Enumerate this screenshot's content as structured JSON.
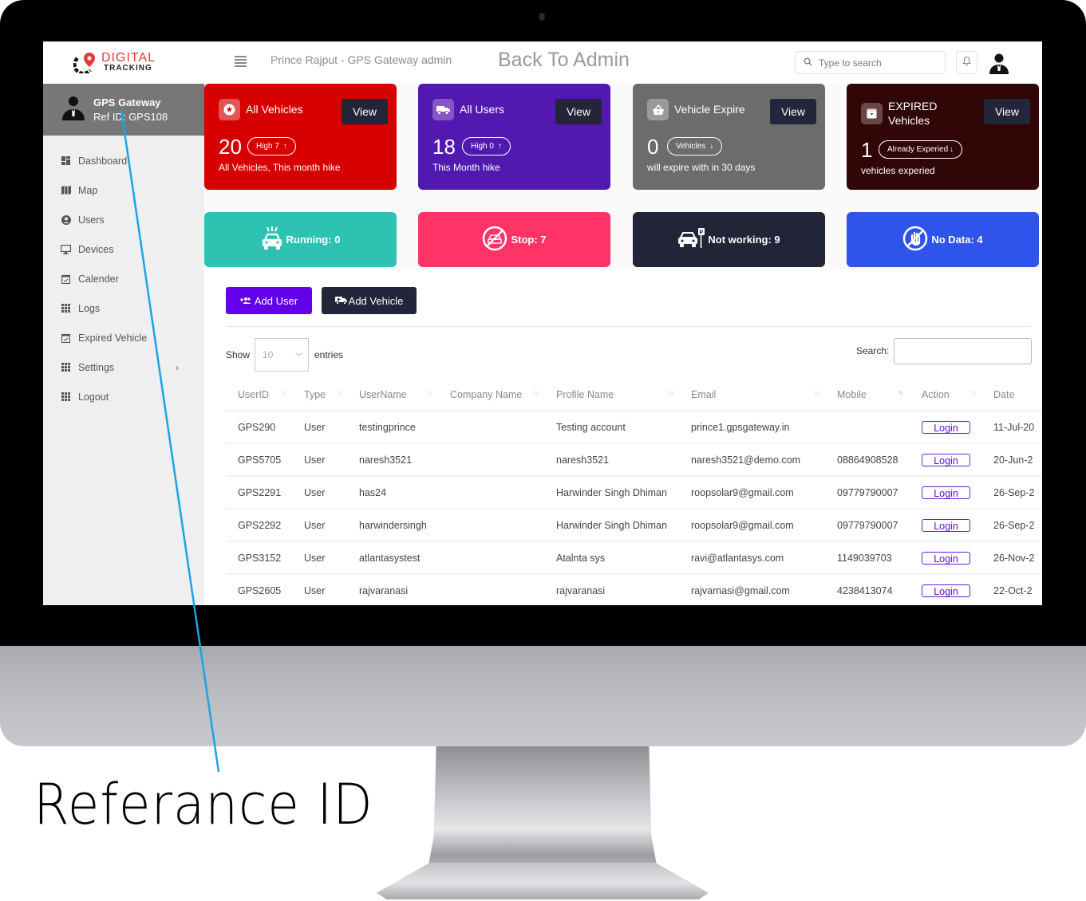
{
  "header": {
    "logo": {
      "line1": "DIGITAL",
      "line2": "TRACKING",
      "icon": "map-pin-logo-icon"
    },
    "admin_title": "Prince Rajput - GPS Gateway admin",
    "back_link": "Back To Admin",
    "search": {
      "placeholder": "Type to search",
      "value": ""
    },
    "icons": [
      "menu-icon",
      "search-icon",
      "bell-icon",
      "user-avatar-icon"
    ]
  },
  "sidebar": {
    "profile": {
      "name": "GPS Gateway",
      "ref_id": "Ref ID: GPS108"
    },
    "items": [
      {
        "label": "Dashboard",
        "icon": "dashboard-icon"
      },
      {
        "label": "Map",
        "icon": "map-icon"
      },
      {
        "label": "Users",
        "icon": "user-circle-icon"
      },
      {
        "label": "Devices",
        "icon": "monitor-icon"
      },
      {
        "label": "Calender",
        "icon": "calendar-check-icon"
      },
      {
        "label": "Logs",
        "icon": "grid-icon"
      },
      {
        "label": "Expired Vehicle",
        "icon": "calendar-check-icon"
      },
      {
        "label": "Settings",
        "icon": "grid-icon",
        "has_submenu": true
      },
      {
        "label": "Logout",
        "icon": "grid-icon"
      }
    ]
  },
  "cards": [
    {
      "title": "All Vehicles",
      "view": "View",
      "value": "20",
      "badge": "High  7",
      "badge_arrow": "↑",
      "subtitle": "All Vehicles, This month hike",
      "color": "#d60000",
      "icon": "star-badge-icon"
    },
    {
      "title": "All Users",
      "view": "View",
      "value": "18",
      "badge": "High  0",
      "badge_arrow": "↑",
      "subtitle": "This Month hike",
      "color": "#5119b0",
      "icon": "truck-icon"
    },
    {
      "title": "Vehicle Expire",
      "view": "View",
      "value": "0",
      "badge": "Vehicles",
      "badge_arrow": "↓",
      "subtitle": "will expire with in 30 days",
      "color": "#6c6c6c",
      "icon": "basket-icon"
    },
    {
      "title_line1": "EXPIRED",
      "title_line2": "Vehicles",
      "view": "View",
      "value": "1",
      "badge": "Already  Experied",
      "badge_arrow": "↓",
      "subtitle": "vehicles experied",
      "color": "#300606",
      "icon": "archive-icon"
    }
  ],
  "status_tiles": [
    {
      "label": "Running: 0",
      "color": "#2ec2b2",
      "icon": "car-siren-icon"
    },
    {
      "label": "Stop: 7",
      "color": "#ff3366",
      "icon": "no-car-icon"
    },
    {
      "label": "Not working: 9",
      "color": "#222437",
      "icon": "car-parking-icon"
    },
    {
      "label": "No Data: 4",
      "color": "#2f54eb",
      "icon": "no-hand-icon"
    }
  ],
  "actions": {
    "add_user": "Add User",
    "add_vehicle": "Add Vehicle"
  },
  "table_controls": {
    "show_label": "Show",
    "page_size": "10",
    "entries_label": "entries",
    "search_label": "Search:",
    "search_value": ""
  },
  "table": {
    "columns": [
      "UserID",
      "Type",
      "UserName",
      "Company Name",
      "Profile Name",
      "Email",
      "Mobile",
      "Action",
      "Date"
    ],
    "rows": [
      {
        "user_id": "GPS290",
        "type": "User",
        "username": "testingprince",
        "company": "",
        "profile": "Testing account",
        "email": "prince1.gpsgateway.in",
        "mobile": "",
        "action": "Login",
        "date": "11-Jul-20"
      },
      {
        "user_id": "GPS5705",
        "type": "User",
        "username": "naresh3521",
        "company": "",
        "profile": "naresh3521",
        "email": "naresh3521@demo.com",
        "mobile": "08864908528",
        "action": "Login",
        "date": "20-Jun-2"
      },
      {
        "user_id": "GPS2291",
        "type": "User",
        "username": "has24",
        "company": "",
        "profile": "Harwinder Singh Dhiman",
        "email": "roopsolar9@gmail.com",
        "mobile": "09779790007",
        "action": "Login",
        "date": "26-Sep-2"
      },
      {
        "user_id": "GPS2292",
        "type": "User",
        "username": "harwindersingh",
        "company": "",
        "profile": "Harwinder Singh Dhiman",
        "email": "roopsolar9@gmail.com",
        "mobile": "09779790007",
        "action": "Login",
        "date": "26-Sep-2"
      },
      {
        "user_id": "GPS3152",
        "type": "User",
        "username": "atlantasystest",
        "company": "",
        "profile": "Atalnta sys",
        "email": "ravi@atlantasys.com",
        "mobile": "1149039703",
        "action": "Login",
        "date": "26-Nov-2"
      },
      {
        "user_id": "GPS2605",
        "type": "User",
        "username": "rajvaranasi",
        "company": "",
        "profile": "rajvaranasi",
        "email": "rajvarnasi@gmail.com",
        "mobile": "4238413074",
        "action": "Login",
        "date": "22-Oct-2"
      }
    ]
  },
  "annotation": {
    "label": "Referance ID",
    "line_color": "#1aa3e8"
  }
}
